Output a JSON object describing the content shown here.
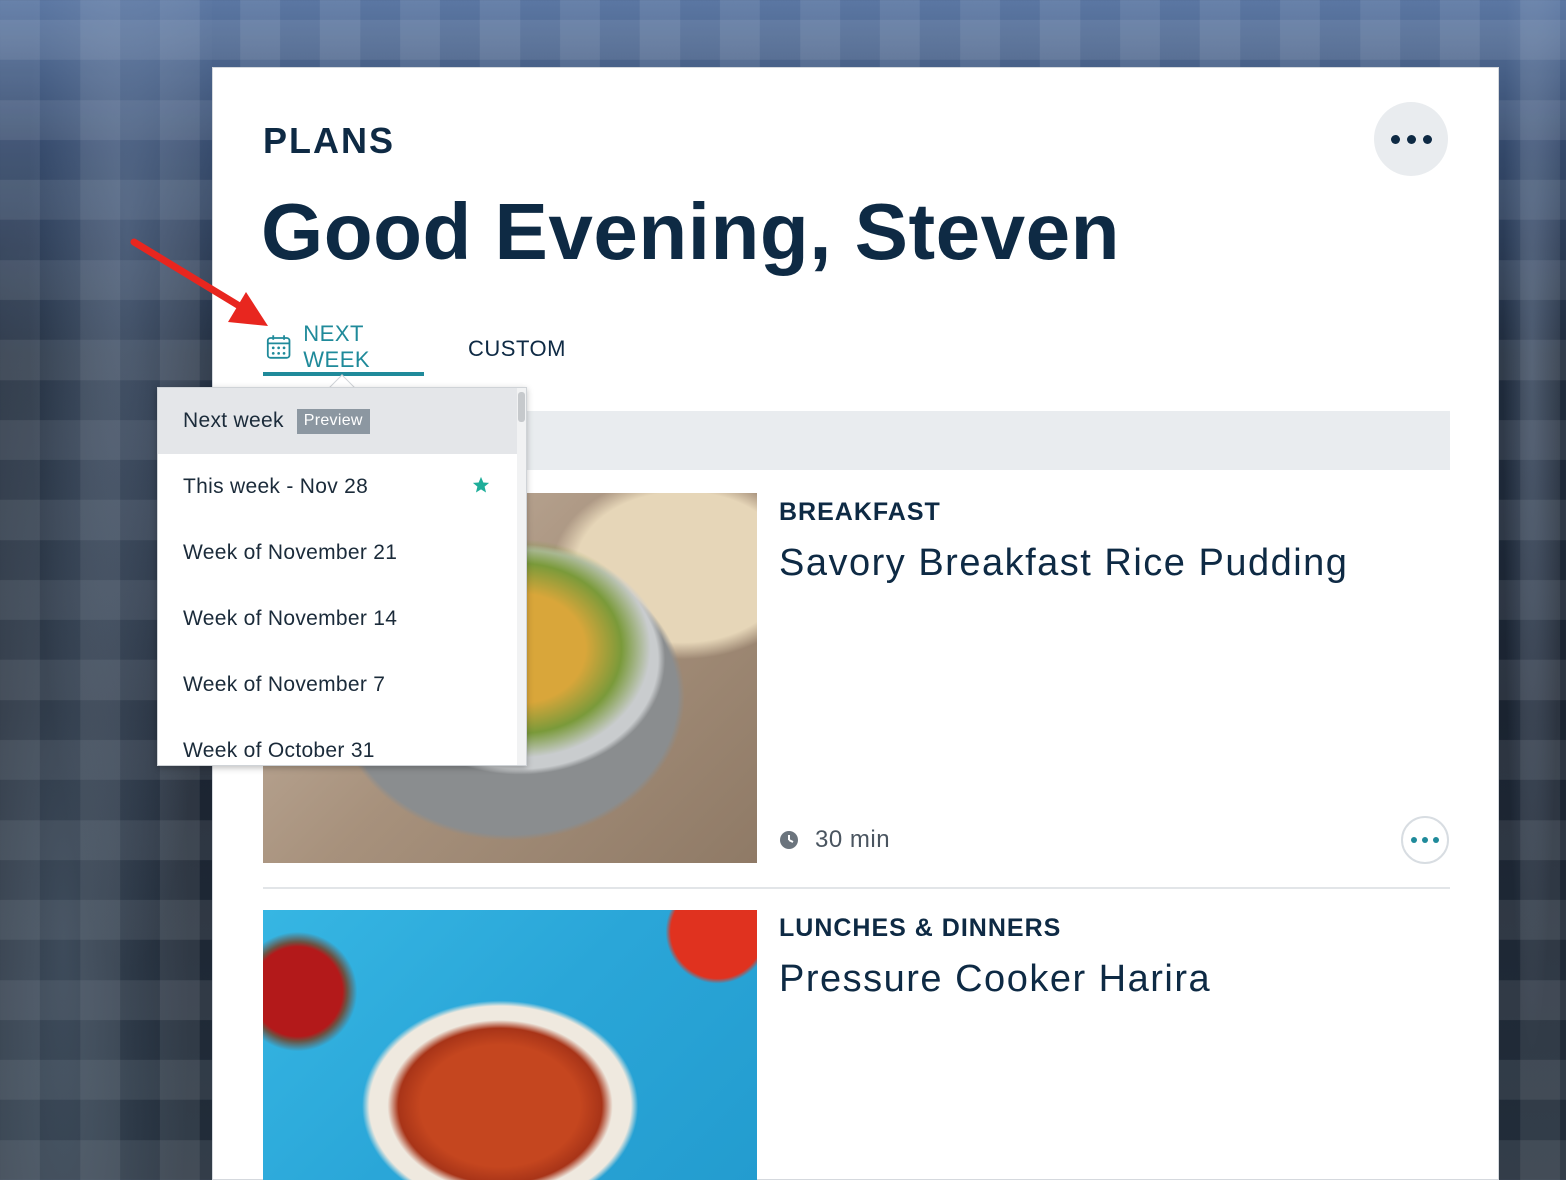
{
  "header": {
    "section_label": "PLANS",
    "greeting": "Good Evening, Steven"
  },
  "tabs": [
    {
      "label": "NEXT WEEK",
      "icon": "calendar-icon",
      "active": true
    },
    {
      "label": "CUSTOM",
      "active": false
    }
  ],
  "week_dropdown": {
    "items": [
      {
        "label": "Next week",
        "badge": "Preview",
        "selected": true
      },
      {
        "label": "This week - Nov 28",
        "icon": "star-icon"
      },
      {
        "label": "Week of November 21"
      },
      {
        "label": "Week of November 14"
      },
      {
        "label": "Week of November 7"
      },
      {
        "label": "Week of October 31"
      }
    ]
  },
  "recipes": [
    {
      "meal_type": "BREAKFAST",
      "title": "Savory Breakfast Rice Pudding",
      "time": "30 min"
    },
    {
      "meal_type": "LUNCHES & DINNERS",
      "title": "Pressure Cooker Harira"
    }
  ],
  "colors": {
    "accent": "#1f8a9a",
    "text_dark": "#0e2a44",
    "annotation_arrow": "#e8261f"
  }
}
